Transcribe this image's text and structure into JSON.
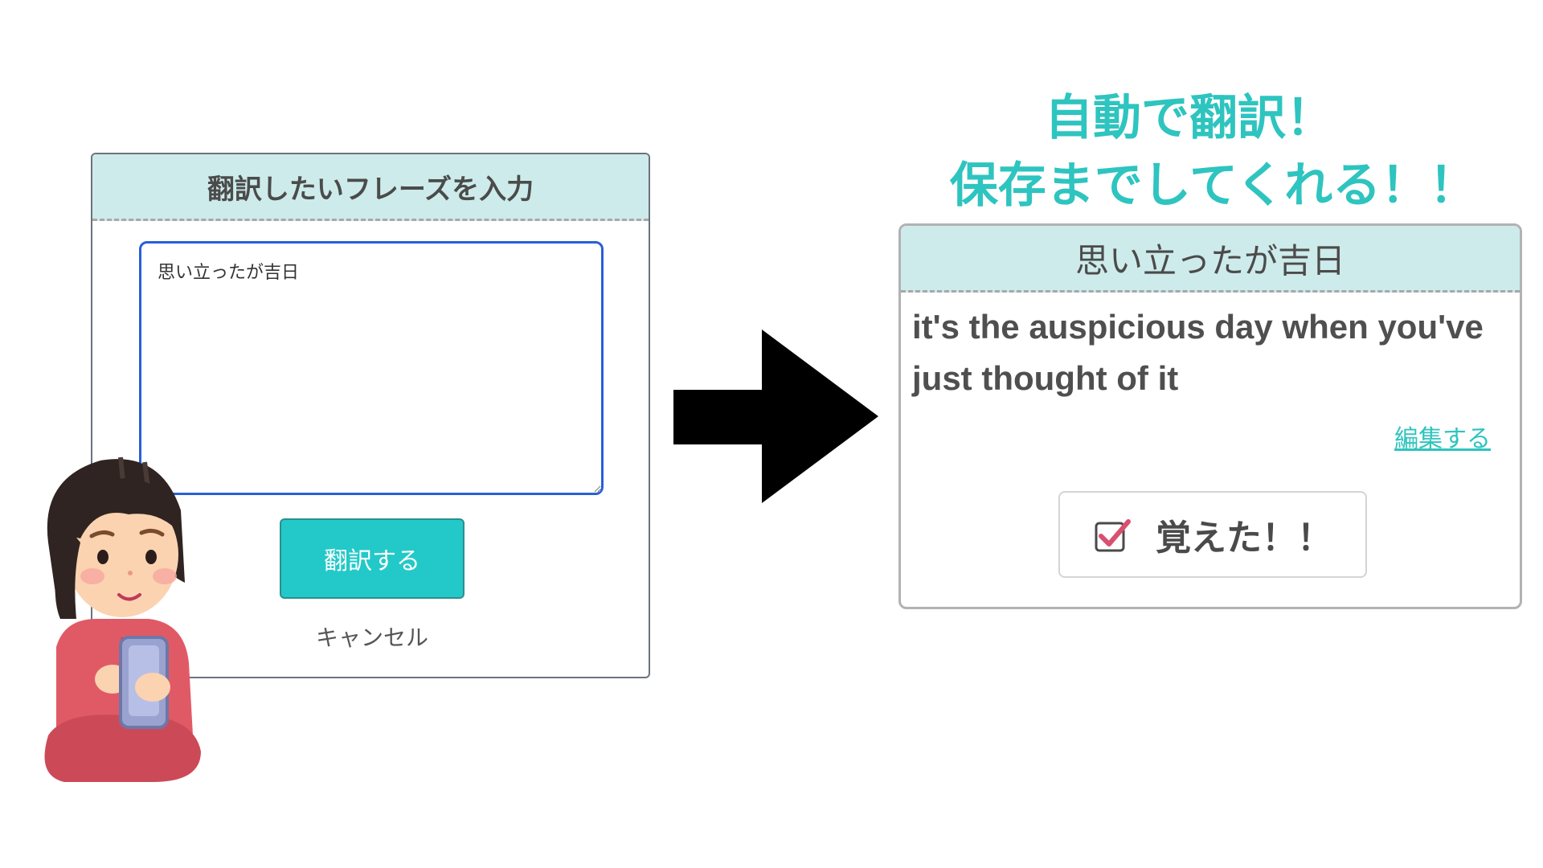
{
  "input_modal": {
    "title": "翻訳したいフレーズを入力",
    "phrase_value": "思い立ったが吉日",
    "translate_button": "翻訳する",
    "cancel_link": "キャンセル"
  },
  "headline": {
    "line1": "自動で翻訳！",
    "line2": "保存までしてくれる！！"
  },
  "result_card": {
    "phrase": "思い立ったが吉日",
    "translation": "it's the auspicious day when you've just thought of it",
    "edit_link": "編集する",
    "learned_button": "覚えた！！"
  },
  "icons": {
    "arrow": "arrow-right-icon",
    "checkbox": "checkbox-checked-icon",
    "character": "girl-with-smartphone-illustration"
  },
  "colors": {
    "accent": "#23c9c8",
    "header_bg": "#cdebea",
    "input_focus_border": "#2a5fd6",
    "headline_text": "#2ec4bf",
    "check_mark": "#d9506f"
  }
}
